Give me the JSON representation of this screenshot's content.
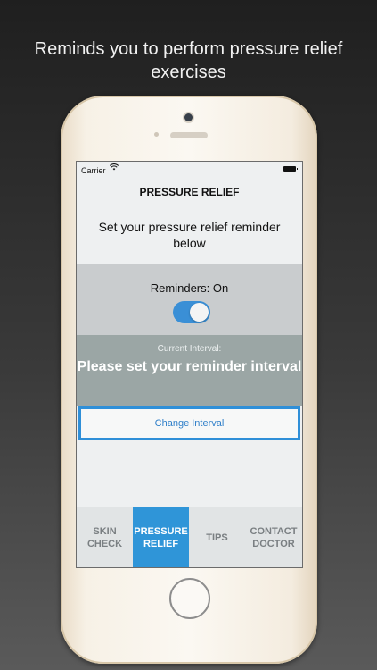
{
  "caption": {
    "line1": "Reminds you to perform pressure relief",
    "line2": "exercises"
  },
  "status_bar": {
    "carrier": "Carrier"
  },
  "screen": {
    "title": "PRESSURE RELIEF",
    "subtitle": "Set your pressure relief reminder below",
    "reminders_label": "Reminders: On",
    "reminders_on": true,
    "interval_label": "Current Interval:",
    "interval_value": "Please set your reminder interval",
    "change_button": "Change Interval"
  },
  "tabs": [
    {
      "label": "SKIN CHECK",
      "active": false
    },
    {
      "label": "PRESSURE RELIEF",
      "active": true
    },
    {
      "label": "TIPS",
      "active": false
    },
    {
      "label": "CONTACT DOCTOR",
      "active": false
    }
  ],
  "colors": {
    "accent": "#2f95d8",
    "interval_panel": "#9ba6a5",
    "reminder_panel": "#c9ccce"
  }
}
